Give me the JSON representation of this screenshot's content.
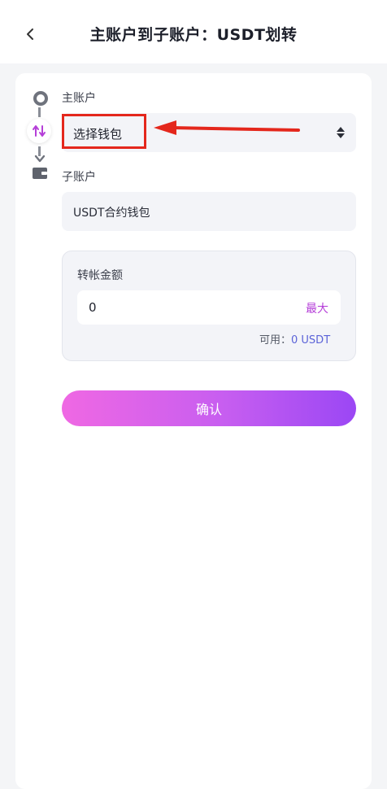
{
  "header": {
    "title": "主账户到子账户：USDT划转",
    "back_icon": "chevron-left-icon"
  },
  "main_account": {
    "label": "主账户",
    "select_value": "选择钱包"
  },
  "sub_account": {
    "label": "子账户",
    "value": "USDT合约钱包"
  },
  "amount": {
    "label": "转帐金额",
    "value": "0",
    "max_label": "最大",
    "available_label": "可用：",
    "available_value": "0 USDT"
  },
  "confirm_label": "确认",
  "colors": {
    "accent": "#b53fd8",
    "annotation": "#e4271c",
    "available": "#5b63d8"
  }
}
